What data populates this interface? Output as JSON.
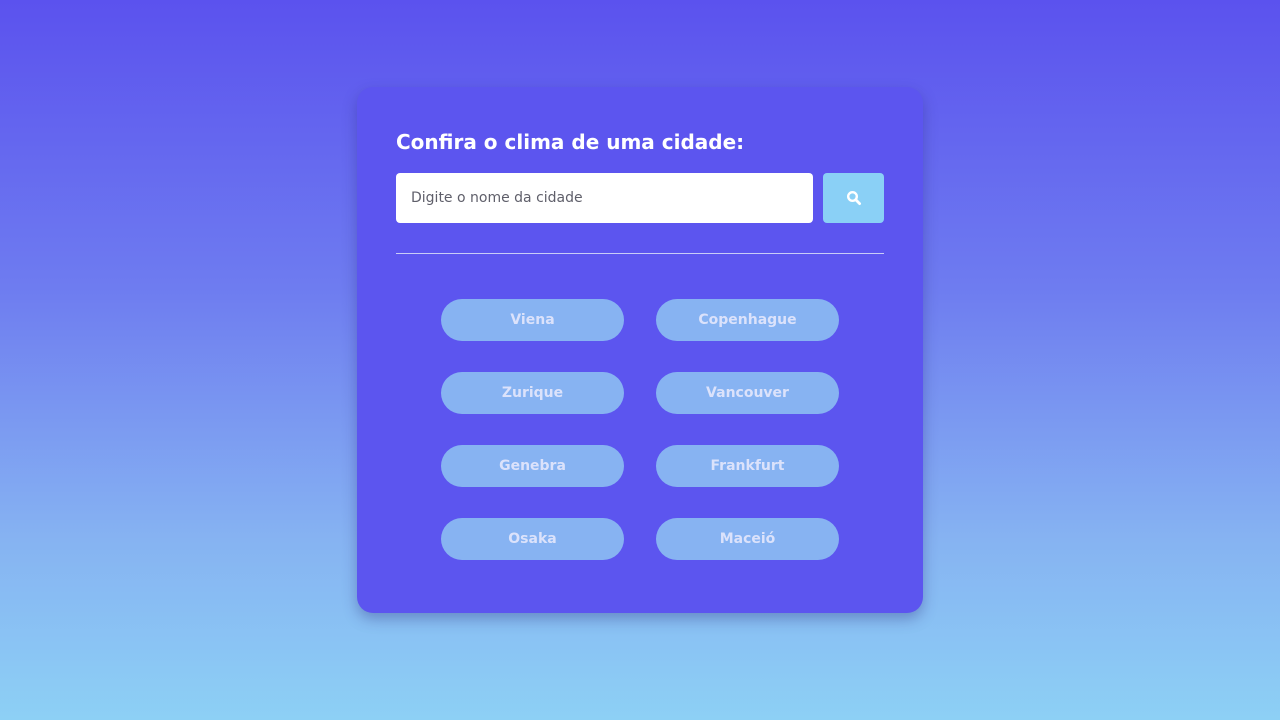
{
  "card": {
    "title": "Confira o clima de uma cidade:"
  },
  "search": {
    "placeholder": "Digite o nome da cidade",
    "value": "",
    "button_icon": "search-icon"
  },
  "cities": [
    {
      "label": "Viena"
    },
    {
      "label": "Copenhague"
    },
    {
      "label": "Zurique"
    },
    {
      "label": "Vancouver"
    },
    {
      "label": "Genebra"
    },
    {
      "label": "Frankfurt"
    },
    {
      "label": "Osaka"
    },
    {
      "label": "Maceió"
    }
  ],
  "colors": {
    "background_top": "#5b52ee",
    "background_bottom": "#8dd0f5",
    "card": "#5c55ef",
    "search_button": "#8ad0f6",
    "city_button": "#87b3f2",
    "city_text": "#dbe2fb"
  }
}
